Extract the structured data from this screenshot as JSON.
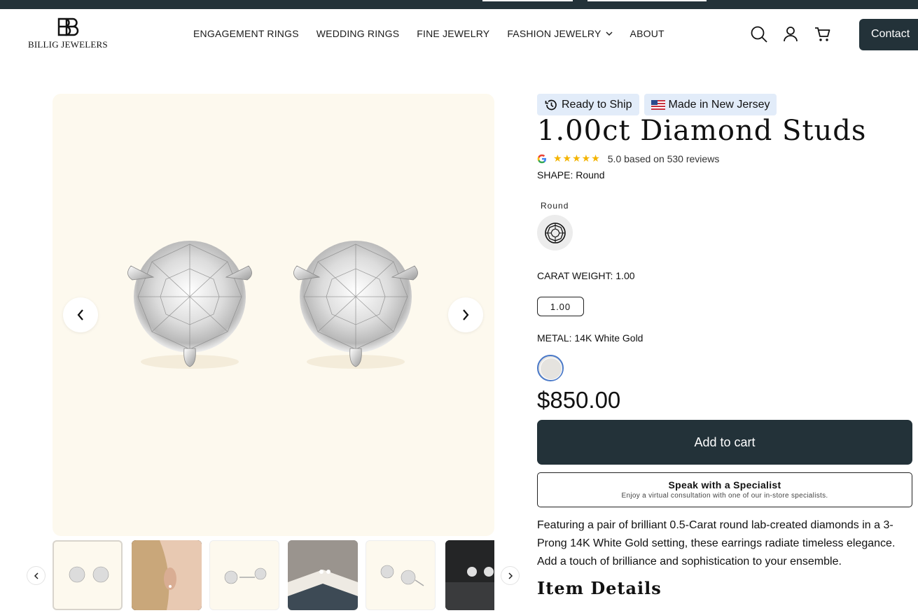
{
  "header": {
    "logo_text": "BILLIG JEWELERS",
    "nav": [
      {
        "label": "ENGAGEMENT RINGS"
      },
      {
        "label": "WEDDING RINGS"
      },
      {
        "label": "FINE JEWELRY"
      },
      {
        "label": "FASHION JEWELRY"
      },
      {
        "label": "ABOUT"
      }
    ],
    "icons": [
      "search-icon",
      "account-icon",
      "cart-icon"
    ],
    "contact_label": "Contact"
  },
  "product": {
    "badges": [
      {
        "label": "Ready to Ship",
        "icon": "history-clock-icon"
      },
      {
        "label": "Made in New Jersey",
        "icon": "us-flag-icon"
      }
    ],
    "title": "1.00ct Diamond Studs",
    "rating": {
      "stars": "★★★★★",
      "value": 5.0,
      "text": "5.0 based on 530 reviews"
    },
    "shape": {
      "label": "SHAPE: Round",
      "option": "Round"
    },
    "carat": {
      "label": "CARAT WEIGHT: 1.00",
      "option": "1.00"
    },
    "metal": {
      "label": "METAL: 14K White Gold",
      "swatch_color": "#e6e4e1"
    },
    "price": "$850.00",
    "add_to_cart": "Add to cart",
    "specialist": {
      "title": "Speak with a Specialist",
      "subtitle": "Enjoy a virtual consultation with one of our in-store specialists."
    },
    "description": "Featuring a pair of brilliant 0.5-Carat round lab-created diamonds in a 3-Prong 14K White Gold setting, these earrings radiate timeless elegance. Add a touch of brilliance and sophistication to your ensemble.",
    "details_heading": "Item Details"
  },
  "colors": {
    "brand_dark": "#233239",
    "gallery_bg": "#fdf9ee",
    "badge_bg": "#e2ecf9",
    "star": "#f4b400"
  }
}
